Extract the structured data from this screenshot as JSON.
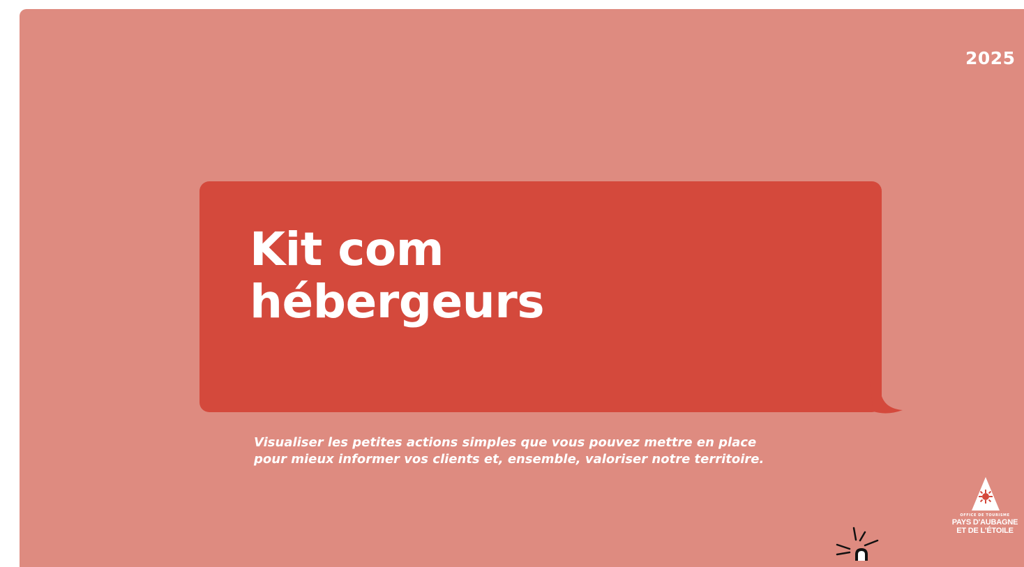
{
  "slide": {
    "year": "2025",
    "title_lines": [
      "Kit com",
      "hébergeurs"
    ],
    "subtitle_lines": [
      "Visualiser les petites actions simples que vous pouvez mettre en place",
      "pour mieux informer vos clients et, ensemble, valoriser notre territoire."
    ],
    "colors": {
      "background": "#de8b80",
      "bubble": "#d4493c",
      "text": "#ffffff"
    }
  },
  "logo": {
    "tagline": "OFFICE DE TOURISME",
    "line1": "PAYS D'AUBAGNE",
    "line2": "ET DE L'ÉTOILE",
    "icon": "mountain-sun-icon"
  },
  "overlay": {
    "icon": "click-cursor-icon"
  }
}
